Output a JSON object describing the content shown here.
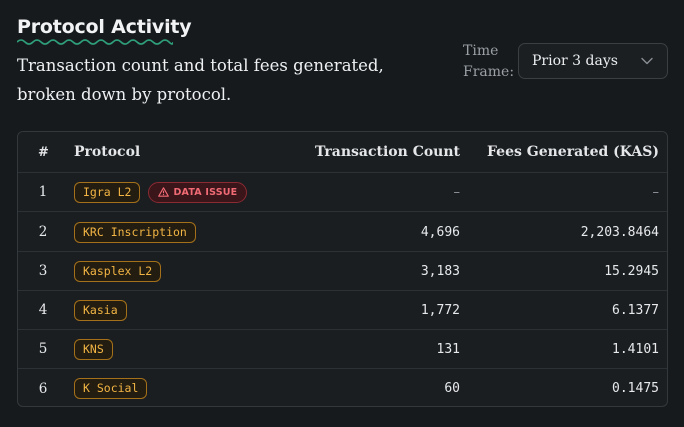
{
  "header": {
    "title": "Protocol Activity",
    "subtitle": "Transaction count and total fees generated, broken down by protocol.",
    "timeframe_label": "Time Frame:",
    "timeframe_value": "Prior 3 days"
  },
  "colors": {
    "accent_amber": "#f2b544",
    "issue_red": "#f06b75",
    "underline_green": "#2f9e7a"
  },
  "table": {
    "columns": [
      "#",
      "Protocol",
      "Transaction Count",
      "Fees Generated (KAS)"
    ],
    "rows": [
      {
        "num": "1",
        "protocol": "Igra L2",
        "badge": "DATA ISSUE",
        "badge_icon": "warning-icon",
        "count": "–",
        "fees": "–"
      },
      {
        "num": "2",
        "protocol": "KRC Inscription",
        "count": "4,696",
        "fees": "2,203.8464"
      },
      {
        "num": "3",
        "protocol": "Kasplex L2",
        "count": "3,183",
        "fees": "15.2945"
      },
      {
        "num": "4",
        "protocol": "Kasia",
        "count": "1,772",
        "fees": "6.1377"
      },
      {
        "num": "5",
        "protocol": "KNS",
        "count": "131",
        "fees": "1.4101"
      },
      {
        "num": "6",
        "protocol": "K Social",
        "count": "60",
        "fees": "0.1475"
      }
    ]
  }
}
